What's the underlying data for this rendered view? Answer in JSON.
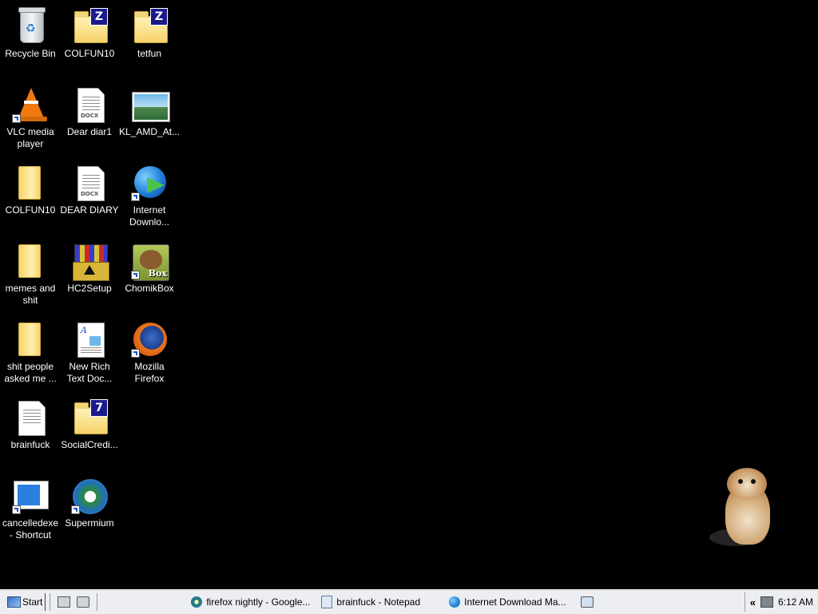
{
  "desktop": {
    "icons": [
      {
        "label": "Recycle Bin",
        "icon": "recycle-bin-icon",
        "shortcut": false
      },
      {
        "label": "COLFUN10",
        "icon": "zip-folder-icon",
        "badge": "Z",
        "shortcut": false
      },
      {
        "label": "tetfun",
        "icon": "zip-folder-icon",
        "badge": "Z",
        "shortcut": false
      },
      {
        "label": "VLC media\nplayer",
        "icon": "vlc-icon",
        "shortcut": true
      },
      {
        "label": "Dear diar1",
        "icon": "docx-icon",
        "tag": "DOCX",
        "shortcut": false
      },
      {
        "label": "KL_AMD_At...",
        "icon": "image-file-icon",
        "shortcut": false
      },
      {
        "label": "COLFUN10",
        "icon": "folder-icon",
        "shortcut": false
      },
      {
        "label": "DEAR DIARY",
        "icon": "docx-icon",
        "tag": "DOCX",
        "shortcut": false
      },
      {
        "label": "Internet\nDownlo...",
        "icon": "internet-download-manager-icon",
        "shortcut": true
      },
      {
        "label": "memes and\nshit",
        "icon": "folder-icon",
        "shortcut": false
      },
      {
        "label": "HC2Setup",
        "icon": "installer-icon",
        "shortcut": false
      },
      {
        "label": "ChomikBox",
        "icon": "chomikbox-icon",
        "badge": "Box",
        "shortcut": true
      },
      {
        "label": "shit people\nasked me ...",
        "icon": "folder-icon",
        "shortcut": false
      },
      {
        "label": "New Rich\nText Doc...",
        "icon": "rtf-document-icon",
        "shortcut": false
      },
      {
        "label": "Mozilla\nFirefox",
        "icon": "firefox-icon",
        "shortcut": true
      },
      {
        "label": "brainfuck",
        "icon": "text-file-icon",
        "shortcut": false
      },
      {
        "label": "SocialCredi...",
        "icon": "7z-folder-icon",
        "badge": "7",
        "shortcut": false
      },
      {
        "label": "cancelledexe\n- Shortcut",
        "icon": "window-app-icon",
        "shortcut": true
      },
      {
        "label": "Supermium",
        "icon": "supermium-icon",
        "shortcut": true
      }
    ]
  },
  "taskbar": {
    "start_label": "Start",
    "tasks": [
      {
        "label": "firefox nightly - Google...",
        "icon": "chrome-icon"
      },
      {
        "label": "brainfuck - Notepad",
        "icon": "notepad-icon"
      },
      {
        "label": "Internet Download Ma...",
        "icon": "internet-download-manager-icon"
      }
    ],
    "tray_chevron": "«",
    "clock": "6:12 AM"
  },
  "colors": {
    "desktop_bg": "#000000",
    "taskbar_bg": "#eceef1"
  }
}
